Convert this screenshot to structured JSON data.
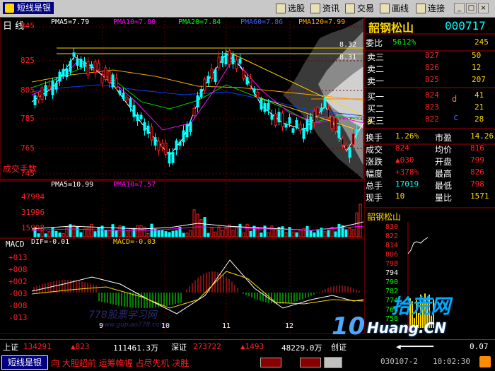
{
  "app": {
    "name": "短线是银"
  },
  "toolbar": {
    "buttons": [
      {
        "label": "选股"
      },
      {
        "label": "资讯"
      },
      {
        "label": "交易"
      },
      {
        "label": "画线"
      },
      {
        "label": "连接"
      }
    ]
  },
  "window_controls": {
    "minimize": "_",
    "restore": "□",
    "close": "×"
  },
  "chart": {
    "period": "日 线",
    "ma_labels": {
      "pma5": "PMA5=7.79",
      "pma10": "PMA10=7.80",
      "pma20": "PMA20=7.84",
      "pma60": "PMA60=7.86",
      "pma120": "PMA120=7.99"
    },
    "price_axis": [
      "845",
      "825",
      "805",
      "785",
      "765",
      "745"
    ],
    "chip_labels": [
      "8.32",
      "8.31"
    ],
    "markers": [
      "b",
      "d",
      "c",
      "a"
    ],
    "volume": {
      "title": "成交手数",
      "pma5": "PMA5=10.99",
      "pma10": "PMA10=7.57",
      "axis": [
        "47994",
        "31996",
        "15998"
      ]
    },
    "macd": {
      "title": "MACD",
      "dif": "DIF=-0.01",
      "macd_val": "MACD=-0.03",
      "axis": [
        "+013",
        "+008",
        "+002",
        "-003",
        "-008",
        "-013"
      ]
    },
    "dates": [
      "9",
      "10",
      "11",
      "12"
    ],
    "watermark": {
      "line1": "778股票学习网",
      "line2": "www.gupiao778.com"
    }
  },
  "stock": {
    "name": "韶钢松山",
    "code": "000717"
  },
  "quote": {
    "weibi": {
      "label": "委比",
      "value": "5612%",
      "diff": "245"
    },
    "sells": [
      {
        "label": "卖三",
        "price": "827",
        "vol": "50"
      },
      {
        "label": "卖二",
        "price": "826",
        "vol": "12"
      },
      {
        "label": "卖一",
        "price": "825",
        "vol": "207"
      }
    ],
    "buys": [
      {
        "label": "买一",
        "price": "824",
        "vol": "41"
      },
      {
        "label": "买二",
        "price": "823",
        "vol": "21"
      },
      {
        "label": "买三",
        "price": "822",
        "vol": "28"
      }
    ],
    "stats": [
      {
        "l1": "换手",
        "v1": "1.26%",
        "l2": "市盈",
        "v2": "14.26"
      },
      {
        "l1": "成交",
        "v1": "824",
        "l2": "均价",
        "v2": "816"
      },
      {
        "l1": "涨跌",
        "v1": "▲030",
        "l2": "开盘",
        "v2": "799"
      },
      {
        "l1": "幅度",
        "v1": "+378%",
        "l2": "最高",
        "v2": "826"
      },
      {
        "l1": "总手",
        "v1": "17019",
        "l2": "最低",
        "v2": "798"
      },
      {
        "l1": "现手",
        "v1": "10",
        "l2": "量比",
        "v2": "1571"
      }
    ]
  },
  "mini": {
    "title": "韶钢松山",
    "axis": [
      "830",
      "822",
      "814",
      "806",
      "798",
      "794",
      "790",
      "782",
      "774",
      "766",
      "758"
    ]
  },
  "brand": {
    "name": "拾荒网",
    "domain": "Huang.CN",
    "prefix": "10"
  },
  "status": {
    "sh_label": "上证",
    "sh_index": "134291",
    "sh_change": "▲823",
    "sh_amount": "111461.3万",
    "sz_label": "深证",
    "sz_index": "273722",
    "sz_change": "▲1493",
    "sz_amount": "48229.0万",
    "cy_label": "创证",
    "cy_value": "0.07"
  },
  "bottom": {
    "app_button": "短线是银",
    "ticker": "向   大胆超前  运筹帷幄  占尽先机  决胜",
    "date": "030107-2",
    "time": "10:02:30"
  }
}
